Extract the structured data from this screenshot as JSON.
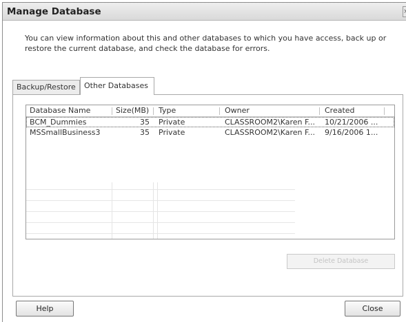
{
  "window": {
    "title": "Manage Database",
    "close_glyph": "×"
  },
  "description": "You can view information about this and other databases to which you have access, back up or restore the current database, and check the database for errors.",
  "tabs": [
    {
      "label": "Backup/Restore",
      "active": false
    },
    {
      "label": "Other Databases",
      "active": true
    }
  ],
  "grid": {
    "columns": [
      "Database Name",
      "Size(MB)",
      "Type",
      "Owner",
      "Created"
    ],
    "rows": [
      {
        "name": "BCM_Dummies",
        "size": "35",
        "type": "Private",
        "owner": "CLASSROOM2\\Karen F...",
        "created": "10/21/2006 ..."
      },
      {
        "name": "MSSmallBusiness3",
        "size": "35",
        "type": "Private",
        "owner": "CLASSROOM2\\Karen F...",
        "created": "9/16/2006 1..."
      }
    ]
  },
  "buttons": {
    "delete": "Delete Database",
    "help": "Help",
    "close": "Close"
  }
}
